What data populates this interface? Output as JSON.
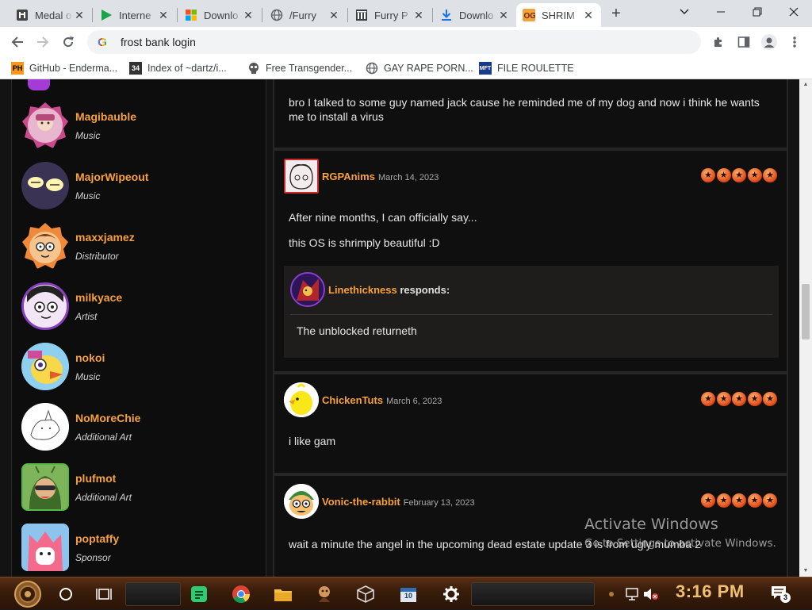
{
  "browser": {
    "tabs": [
      {
        "title": "Medal o",
        "icon": "medal-icon",
        "active": false
      },
      {
        "title": "Interne",
        "icon": "play-icon",
        "active": false
      },
      {
        "title": "Downlo",
        "icon": "windows-icon",
        "active": false
      },
      {
        "title": "/Furry",
        "icon": "globe-icon",
        "active": false
      },
      {
        "title": "Furry P",
        "icon": "museum-icon",
        "active": false
      },
      {
        "title": "Downlo",
        "icon": "download-icon",
        "active": false
      },
      {
        "title": "SHRIM",
        "icon": "og-icon",
        "active": true
      }
    ],
    "close_glyph": "✕",
    "new_tab_glyph": "+",
    "address": "frost bank login",
    "bookmarks": [
      {
        "label": "GitHub - Enderma...",
        "icon": "PH"
      },
      {
        "label": "Index of ~dartz/i...",
        "icon": "34"
      },
      {
        "label": "Free Transgender...",
        "icon": "skull"
      },
      {
        "label": "GAY RAPE PORN...",
        "icon": "globe"
      },
      {
        "label": "FILE ROULETTE",
        "icon": "MFT"
      }
    ]
  },
  "members": [
    {
      "name": "Magibauble",
      "role": "Music"
    },
    {
      "name": "MajorWipeout",
      "role": "Music"
    },
    {
      "name": "maxxjamez",
      "role": "Distributor"
    },
    {
      "name": "milkyace",
      "role": "Artist"
    },
    {
      "name": "nokoi",
      "role": "Music"
    },
    {
      "name": "NoMoreChie",
      "role": "Additional Art"
    },
    {
      "name": "plufmot",
      "role": "Additional Art"
    },
    {
      "name": "poptaffy",
      "role": "Sponsor"
    }
  ],
  "posts": [
    {
      "user": "",
      "date": "",
      "lines": [
        "bro I talked to some guy named jack cause he reminded me of my dog and now i think he wants",
        "me to install a virus"
      ]
    },
    {
      "user": "RGPAnims",
      "date": "March 14, 2023",
      "rating": 5,
      "lines": [
        "After nine months, I can officially say...",
        "this OS is shrimply beautiful :D"
      ],
      "reply": {
        "user": "Linethickness",
        "suffix": "responds:",
        "text": "The unblocked returneth"
      }
    },
    {
      "user": "ChickenTuts",
      "date": "March 6, 2023",
      "rating": 5,
      "lines": [
        "i like gam"
      ]
    },
    {
      "user": "Vonic-the-rabbit",
      "date": "February 13, 2023",
      "rating": 5,
      "lines": [
        "wait a minute the angel in the upcoming dead estate update 3 is from ugly mumba 2"
      ]
    }
  ],
  "star_glyph": "★",
  "watermark": {
    "title": "Activate Windows",
    "subtitle": "Go to Settings to activate Windows."
  },
  "taskbar": {
    "clock": "3:16 PM",
    "notification_count": "3",
    "calendar_day": "10"
  }
}
